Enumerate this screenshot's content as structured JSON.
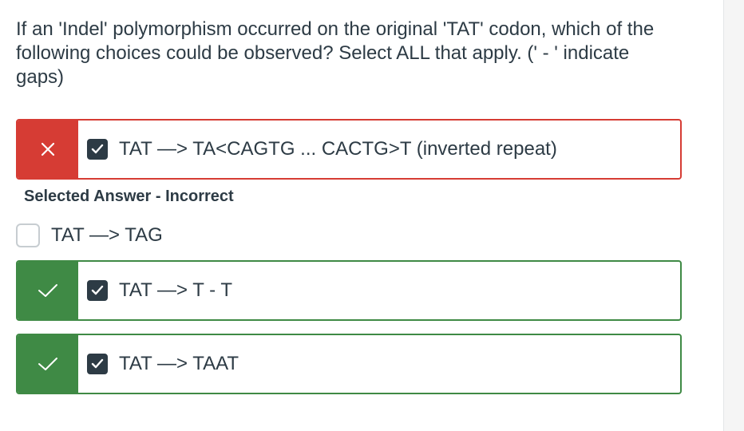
{
  "question": {
    "text": "If an 'Indel' polymorphism occurred on the original 'TAT' codon, which of the following choices could be observed? Select ALL that apply. (' - ' indicate gaps)"
  },
  "answers": [
    {
      "text": "TAT —> TA<CAGTG ... CACTG>T (inverted repeat)",
      "selected": true,
      "status": "incorrect",
      "status_icon": "x-icon",
      "color": "#d63c34"
    },
    {
      "text": "TAT —> TAG",
      "selected": false,
      "status": "none"
    },
    {
      "text": "TAT —> T - T",
      "selected": true,
      "status": "correct",
      "status_icon": "check-icon",
      "color": "#3f8a45"
    },
    {
      "text": "TAT —> TAAT",
      "selected": true,
      "status": "correct",
      "status_icon": "check-icon",
      "color": "#3f8a45"
    }
  ],
  "feedback": {
    "selected_incorrect": "Selected Answer - Incorrect"
  }
}
